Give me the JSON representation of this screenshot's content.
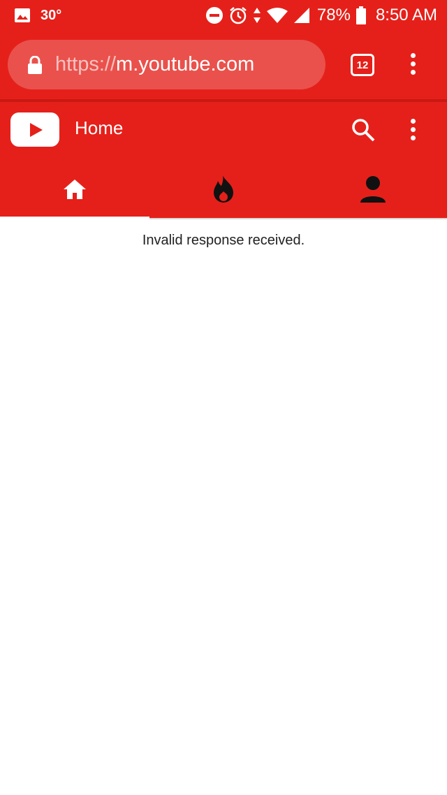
{
  "status_bar": {
    "temperature": "30°",
    "battery_percent": "78%",
    "time": "8:50 AM",
    "icons": [
      "gallery-icon",
      "do-not-disturb-icon",
      "alarm-icon",
      "data-arrows-icon",
      "wifi-icon",
      "signal-icon",
      "battery-icon"
    ]
  },
  "browser": {
    "url_scheme": "https://",
    "url_host": "m.youtube.com",
    "tab_count": "12"
  },
  "header": {
    "title": "Home"
  },
  "tabs": [
    {
      "name": "home",
      "icon": "home-icon",
      "selected": true
    },
    {
      "name": "trending",
      "icon": "flame-icon",
      "selected": false
    },
    {
      "name": "account",
      "icon": "person-icon",
      "selected": false
    }
  ],
  "content": {
    "message": "Invalid response received."
  },
  "colors": {
    "accent": "#e5201a",
    "text": "#212121",
    "background": "#ffffff"
  }
}
